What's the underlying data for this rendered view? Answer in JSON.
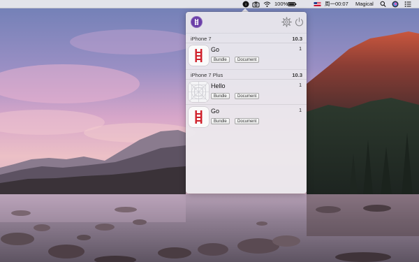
{
  "menubar": {
    "battery": "100%",
    "datetime": "周一00:07",
    "user": "Magical",
    "icons": [
      "app-status-icon",
      "camera-icon",
      "wifi-icon",
      "battery-icon",
      "flag-icon",
      "search-icon",
      "siri-icon",
      "notification-center-icon"
    ]
  },
  "popover": {
    "header": {
      "logo_icon": "app-logo-icon",
      "settings_icon": "gear-icon",
      "quit_icon": "power-icon"
    },
    "sections": [
      {
        "device": "iPhone 7",
        "version": "10.3",
        "apps": [
          {
            "name": "Go",
            "count": "1",
            "icon": "ladder-icon",
            "bundle_label": "Bundle",
            "document_label": "Document"
          }
        ]
      },
      {
        "device": "iPhone 7 Plus",
        "version": "10.3",
        "apps": [
          {
            "name": "Hello",
            "count": "1",
            "icon": "placeholder-grid-icon",
            "bundle_label": "Bundle",
            "document_label": "Document"
          },
          {
            "name": "Go",
            "count": "1",
            "icon": "ladder-icon",
            "bundle_label": "Bundle",
            "document_label": "Document"
          }
        ]
      }
    ]
  },
  "colors": {
    "accent": "#6b3fa8",
    "ladder": "#d0202a"
  }
}
